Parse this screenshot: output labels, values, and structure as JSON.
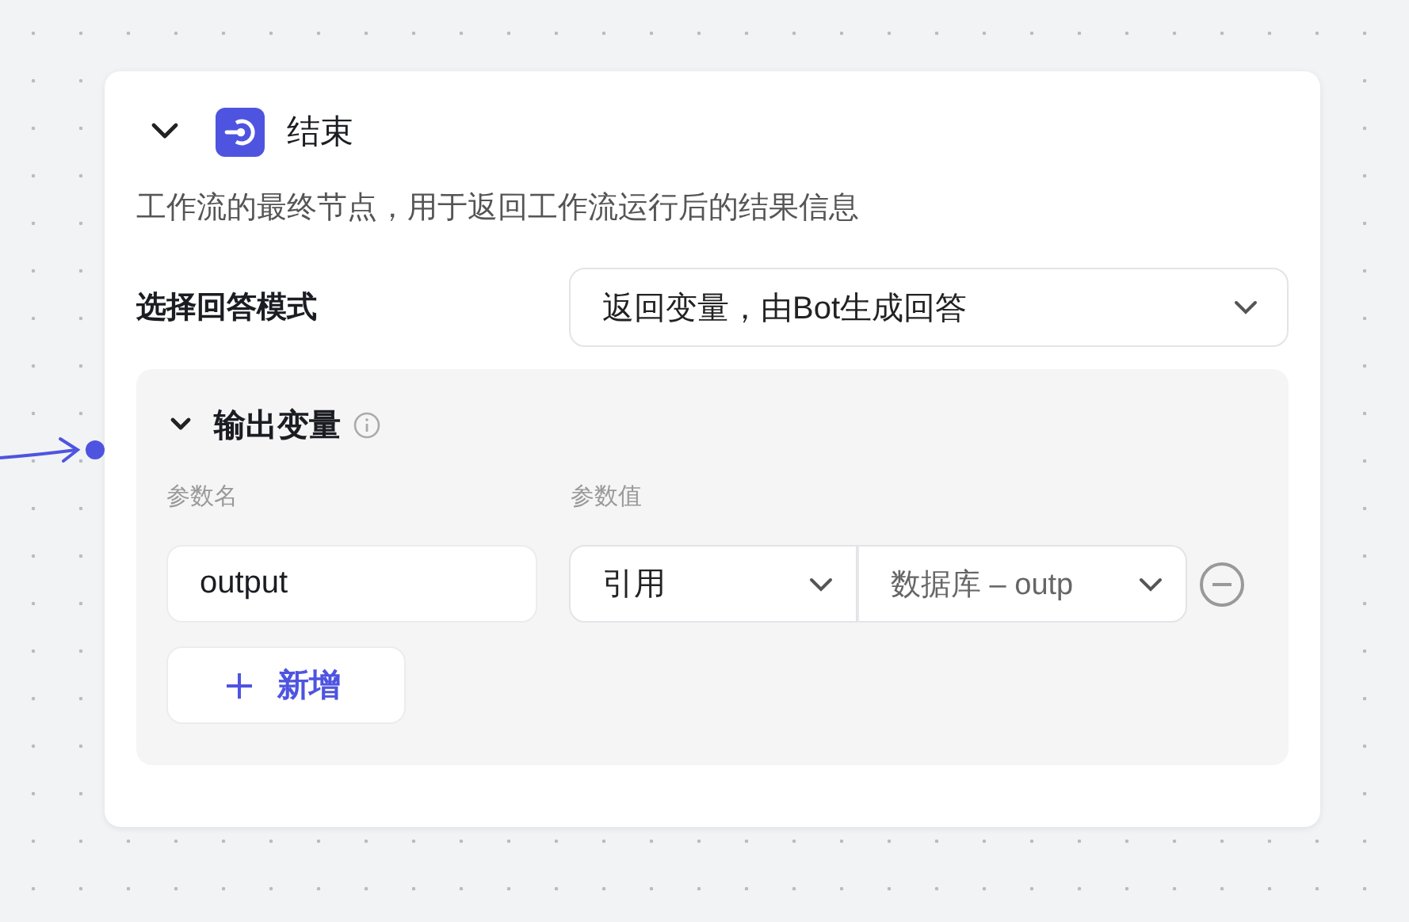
{
  "node": {
    "expanded": true,
    "title": "结束",
    "description": "工作流的最终节点，用于返回工作流运行后的结果信息"
  },
  "answer_mode": {
    "label": "选择回答模式",
    "value": "返回变量，由Bot生成回答"
  },
  "output_section": {
    "expanded": true,
    "title": "输出变量",
    "columns": [
      "参数名",
      "参数值"
    ],
    "rows": [
      {
        "name": "output",
        "source": "引用",
        "value": "数据库 – outp"
      }
    ],
    "add_button": "新增"
  }
}
